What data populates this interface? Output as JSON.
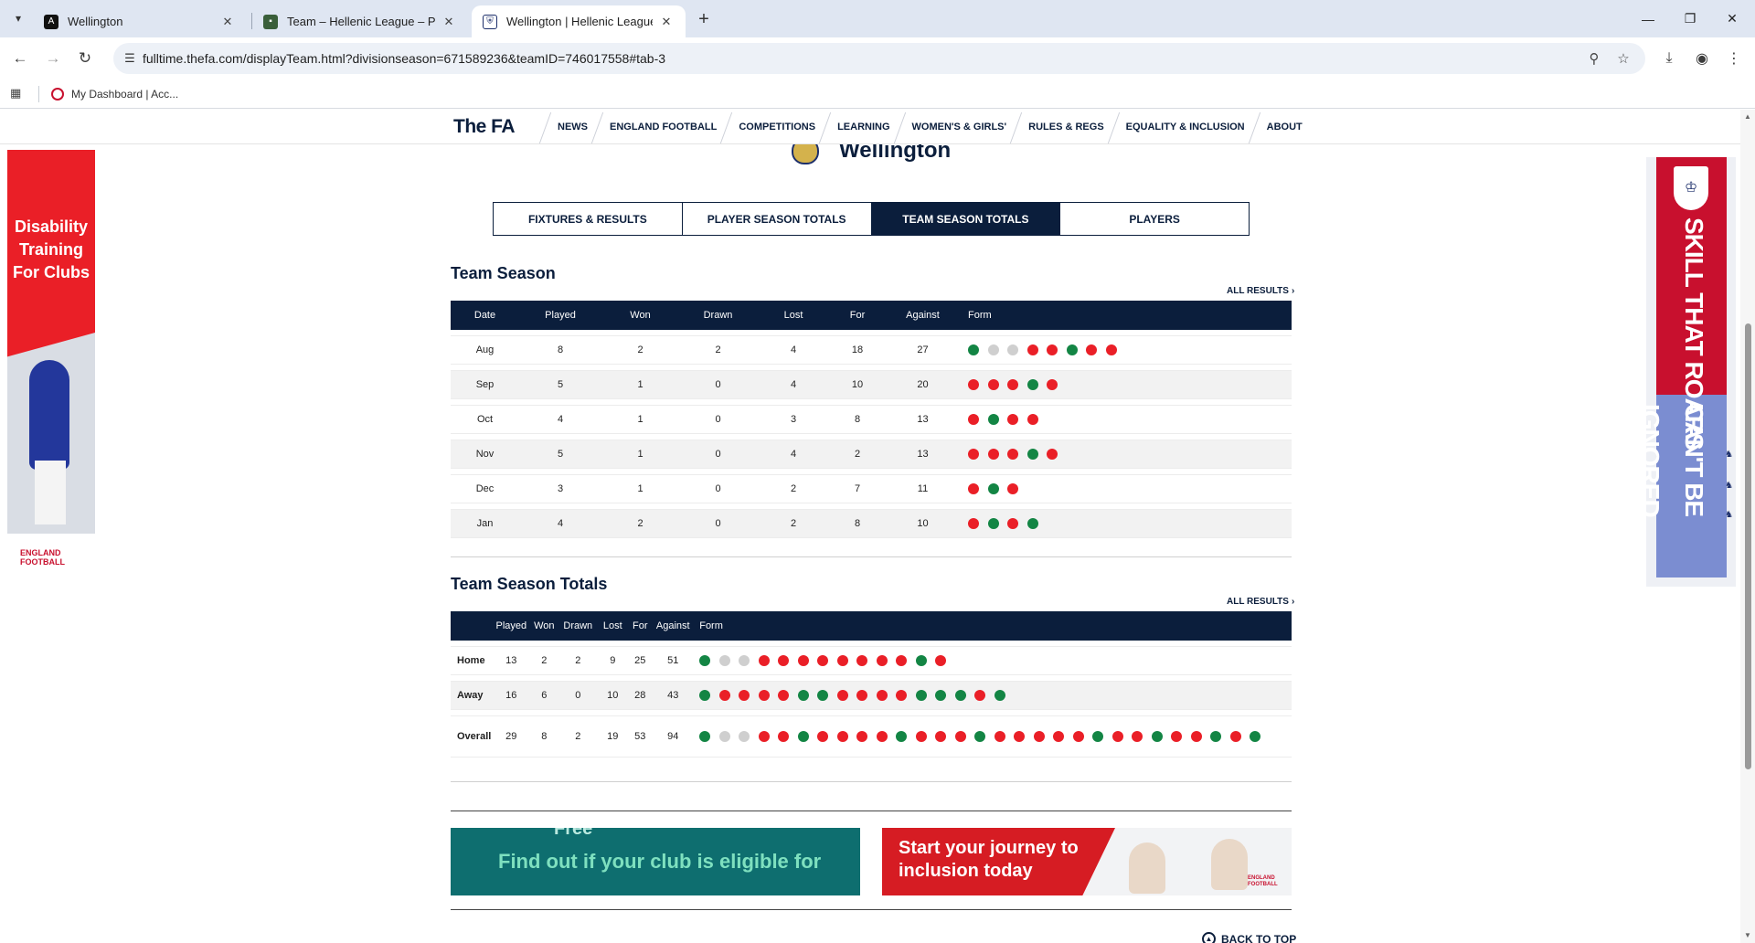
{
  "browser": {
    "tabs": [
      {
        "title": "Wellington",
        "active": false
      },
      {
        "title": "Team – Hellenic League – Proud",
        "active": false
      },
      {
        "title": "Wellington | Hellenic League - F",
        "active": true
      }
    ],
    "url": "fulltime.thefa.com/displayTeam.html?divisionseason=671589236&teamID=746017558#tab-3",
    "bookmark": "My Dashboard | Acc..."
  },
  "site": {
    "logo": "The FA",
    "nav": [
      "NEWS",
      "ENGLAND FOOTBALL",
      "COMPETITIONS",
      "LEARNING",
      "WOMEN'S & GIRLS'",
      "RULES & REGS",
      "EQUALITY & INCLUSION",
      "ABOUT"
    ]
  },
  "team": {
    "name": "Wellington"
  },
  "page_tabs": [
    {
      "label": "FIXTURES & RESULTS",
      "active": false
    },
    {
      "label": "PLAYER SEASON TOTALS",
      "active": false
    },
    {
      "label": "TEAM SEASON TOTALS",
      "active": true
    },
    {
      "label": "PLAYERS",
      "active": false
    }
  ],
  "team_season": {
    "title": "Team Season",
    "all_results": "ALL RESULTS",
    "headers": [
      "Date",
      "Played",
      "Won",
      "Drawn",
      "Lost",
      "For",
      "Against",
      "Form"
    ],
    "rows": [
      {
        "date": "Aug",
        "played": "8",
        "won": "2",
        "drawn": "2",
        "lost": "4",
        "for": "18",
        "against": "27",
        "form": "WDDLLWLL"
      },
      {
        "date": "Sep",
        "played": "5",
        "won": "1",
        "drawn": "0",
        "lost": "4",
        "for": "10",
        "against": "20",
        "form": "LLLWL"
      },
      {
        "date": "Oct",
        "played": "4",
        "won": "1",
        "drawn": "0",
        "lost": "3",
        "for": "8",
        "against": "13",
        "form": "LWLL"
      },
      {
        "date": "Nov",
        "played": "5",
        "won": "1",
        "drawn": "0",
        "lost": "4",
        "for": "2",
        "against": "13",
        "form": "LLLWL"
      },
      {
        "date": "Dec",
        "played": "3",
        "won": "1",
        "drawn": "0",
        "lost": "2",
        "for": "7",
        "against": "11",
        "form": "LWL"
      },
      {
        "date": "Jan",
        "played": "4",
        "won": "2",
        "drawn": "0",
        "lost": "2",
        "for": "8",
        "against": "10",
        "form": "LWLW"
      }
    ]
  },
  "team_totals": {
    "title": "Team Season Totals",
    "all_results": "ALL RESULTS",
    "headers": [
      "",
      "Played",
      "Won",
      "Drawn",
      "Lost",
      "For",
      "Against",
      "Form"
    ],
    "rows": [
      {
        "label": "Home",
        "played": "13",
        "won": "2",
        "drawn": "2",
        "lost": "9",
        "for": "25",
        "against": "51",
        "form": "WDDLLLLLLLLWL"
      },
      {
        "label": "Away",
        "played": "16",
        "won": "6",
        "drawn": "0",
        "lost": "10",
        "for": "28",
        "against": "43",
        "form": "WLLLLWWLLLLWWWLW"
      },
      {
        "label": "Overall",
        "played": "29",
        "won": "8",
        "drawn": "2",
        "lost": "19",
        "for": "53",
        "against": "94",
        "form": "WDDLLWLLLLWLLLWLLLLLWLLWLLWLW"
      }
    ]
  },
  "ads": {
    "left": "Disability Training For Clubs",
    "left_logo": "ENGLAND FOOTBALL",
    "right_top": "SKILL THAT ROARS",
    "right_bottom": "CAN'T BE IGNORED",
    "banner1_top": "Free",
    "banner1": "Find out if your club is eligible for",
    "banner2": "Start your journey to inclusion today",
    "banner2_logo": "ENGLAND FOOTBALL"
  },
  "back_to_top": "BACK TO TOP",
  "colors": {
    "win": "#138544",
    "loss": "#ea1f27",
    "draw": "#cfcfcf",
    "navy": "#0b1e3c"
  }
}
